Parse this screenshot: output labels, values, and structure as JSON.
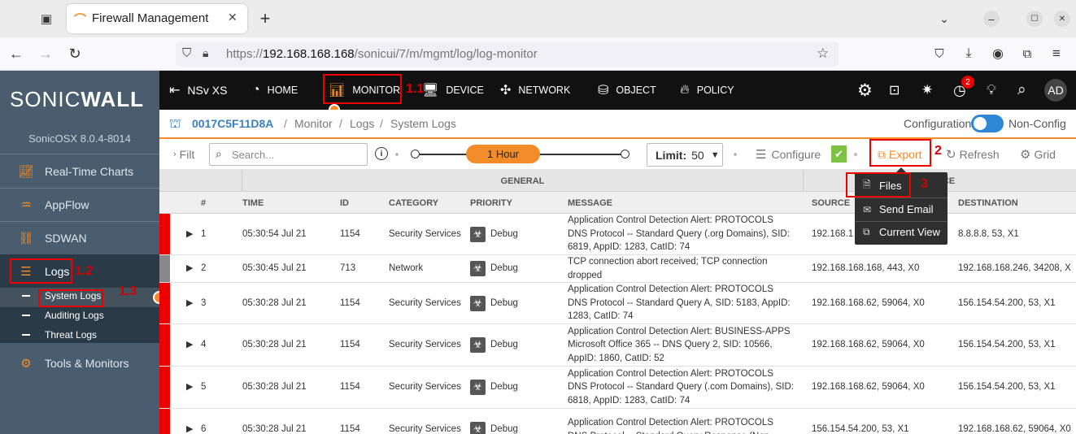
{
  "browser": {
    "tab_title": "Firewall Management",
    "url_prefix": "https://",
    "url_host": "192.168.168.168",
    "url_path": "/sonicui/7/m/mgmt/log/log-monitor",
    "new_tab": "+"
  },
  "sidebar": {
    "logo_left": "SONIC",
    "logo_right": "WALL",
    "version": "SonicOSX 8.0.4-8014",
    "items": [
      {
        "label": "Real-Time Charts",
        "icon": "chart-line-icon"
      },
      {
        "label": "AppFlow",
        "icon": "appflow-icon"
      },
      {
        "label": "SDWAN",
        "icon": "sdwan-icon"
      },
      {
        "label": "Logs",
        "icon": "logs-icon"
      },
      {
        "label": "Tools & Monitors",
        "icon": "gears-icon"
      }
    ],
    "logs_sub": [
      "System Logs",
      "Auditing Logs",
      "Threat Logs"
    ]
  },
  "topnav": {
    "model": "NSv XS",
    "items": [
      "HOME",
      "MONITOR",
      "DEVICE",
      "NETWORK",
      "OBJECT",
      "POLICY"
    ],
    "notif_count": "2",
    "avatar": "AD"
  },
  "breadcrumb": {
    "device": "0017C5F11D8A",
    "sep": "/",
    "parts": [
      "Monitor",
      "Logs",
      "System Logs"
    ],
    "config_label": "Configuration",
    "nonconfig_label": "Non-Config"
  },
  "toolbar": {
    "filter": "Filt",
    "search_placeholder": "Search...",
    "range": "1 Hour",
    "limit_label": "Limit:",
    "limit_value": "50",
    "configure": "Configure",
    "export": "Export",
    "refresh": "Refresh",
    "grid": "Grid"
  },
  "export_menu": [
    "Files",
    "Send Email",
    "Current View"
  ],
  "table": {
    "group_general": "GENERAL",
    "group_interface": "RFACE",
    "columns": [
      "#",
      "TIME",
      "ID",
      "CATEGORY",
      "PRIORITY",
      "MESSAGE",
      "SOURCE",
      "DESTINATION"
    ],
    "rows": [
      {
        "num": "1",
        "time": "05:30:54 Jul 21",
        "id": "1154",
        "category": "Security Services",
        "priority": "Debug",
        "message": "Application Control Detection Alert: PROTOCOLS DNS Protocol -- Standard Query (.org Domains), SID: 6819, AppID: 1283, CatID: 74",
        "source": "192.168.1",
        "destination": "8.8.8.8, 53, X1"
      },
      {
        "num": "2",
        "time": "05:30:45 Jul 21",
        "id": "713",
        "category": "Network",
        "priority": "Debug",
        "message": "TCP connection abort received; TCP connection dropped",
        "source": "192.168.168.168, 443, X0",
        "destination": "192.168.168.246, 34208, X"
      },
      {
        "num": "3",
        "time": "05:30:28 Jul 21",
        "id": "1154",
        "category": "Security Services",
        "priority": "Debug",
        "message": "Application Control Detection Alert: PROTOCOLS DNS Protocol -- Standard Query A, SID: 5183, AppID: 1283, CatID: 74",
        "source": "192.168.168.62, 59064, X0",
        "destination": "156.154.54.200, 53, X1"
      },
      {
        "num": "4",
        "time": "05:30:28 Jul 21",
        "id": "1154",
        "category": "Security Services",
        "priority": "Debug",
        "message": "Application Control Detection Alert: BUSINESS-APPS Microsoft Office 365 -- DNS Query 2, SID: 10566, AppID: 1860, CatID: 52",
        "source": "192.168.168.62, 59064, X0",
        "destination": "156.154.54.200, 53, X1"
      },
      {
        "num": "5",
        "time": "05:30:28 Jul 21",
        "id": "1154",
        "category": "Security Services",
        "priority": "Debug",
        "message": "Application Control Detection Alert: PROTOCOLS DNS Protocol -- Standard Query (.com Domains), SID: 6818, AppID: 1283, CatID: 74",
        "source": "192.168.168.62, 59064, X0",
        "destination": "156.154.54.200, 53, X1"
      },
      {
        "num": "6",
        "time": "05:30:28 Jul 21",
        "id": "1154",
        "category": "Security Services",
        "priority": "Debug",
        "message": "Application Control Detection Alert: PROTOCOLS DNS Protocol -- Standard Query Response (Non-",
        "source": "156.154.54.200, 53, X1",
        "destination": "192.168.168.62, 59064, X0"
      }
    ]
  },
  "annotations": [
    "1.1",
    "1.2",
    "1.3",
    "2",
    "3"
  ],
  "colors": {
    "accent": "#f28c28",
    "sidebar": "#4a5d6e",
    "topnav": "#111111",
    "flag": "#ee0000",
    "link": "#3a7fc2"
  }
}
